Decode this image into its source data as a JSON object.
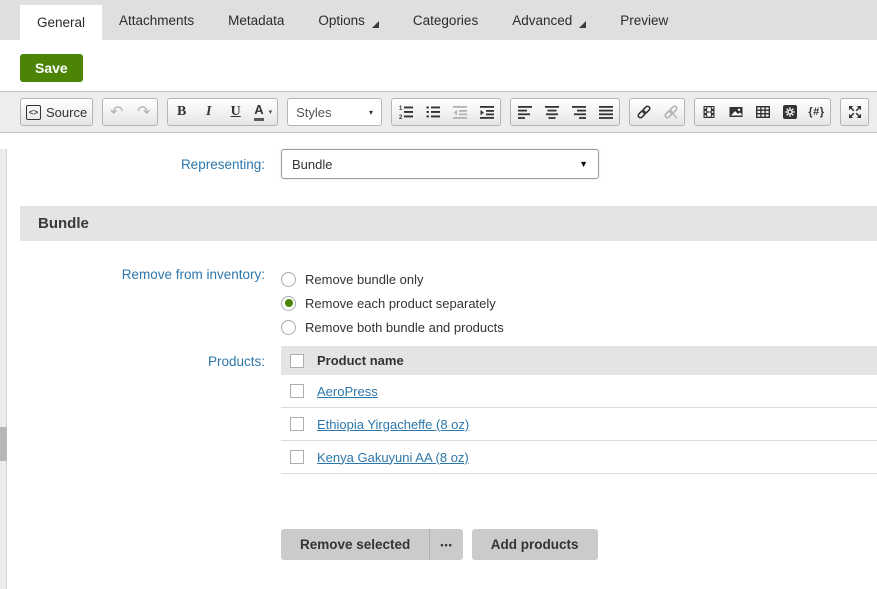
{
  "tabs": [
    {
      "label": "General",
      "active": true
    },
    {
      "label": "Attachments"
    },
    {
      "label": "Metadata"
    },
    {
      "label": "Options",
      "dropdown": true
    },
    {
      "label": "Categories"
    },
    {
      "label": "Advanced",
      "dropdown": true
    },
    {
      "label": "Preview"
    }
  ],
  "actions": {
    "save": "Save"
  },
  "editor_toolbar": {
    "source_label": "Source",
    "source_icon_glyph": "<>",
    "undo_glyph": "↶",
    "redo_glyph": "↷",
    "bold_glyph": "B",
    "italic_glyph": "I",
    "underline_glyph": "U",
    "text_color_glyph": "A",
    "styles_label": "Styles",
    "styles_caret": "▼",
    "macro_glyph": "{#}"
  },
  "icons": {
    "select_caret": "▼",
    "dropdown_caret": "▾",
    "ellipsis": "•••"
  },
  "form": {
    "representing": {
      "label": "Representing:",
      "value": "Bundle"
    },
    "section_title": "Bundle",
    "remove_from_inventory": {
      "label": "Remove from inventory:",
      "options": [
        {
          "label": "Remove bundle only",
          "selected": false
        },
        {
          "label": "Remove each product separately",
          "selected": true
        },
        {
          "label": "Remove both bundle and products",
          "selected": false
        }
      ]
    },
    "products": {
      "label": "Products:",
      "column_header": "Product name",
      "rows": [
        {
          "name": "AeroPress",
          "checked": false
        },
        {
          "name": "Ethiopia Yirgacheffe (8 oz)",
          "checked": false
        },
        {
          "name": "Kenya Gakuyuni AA (8 oz)",
          "checked": false
        }
      ],
      "actions": {
        "remove_selected": "Remove selected",
        "add_products": "Add products"
      }
    }
  },
  "colors": {
    "accent_green": "#4c8405",
    "label_blue": "#2d77ab",
    "link_blue": "#2d77ab",
    "section_bg": "#e4e4e4",
    "tabbar_bg": "#dfdfdf",
    "button_gray": "#cbcbcb"
  }
}
